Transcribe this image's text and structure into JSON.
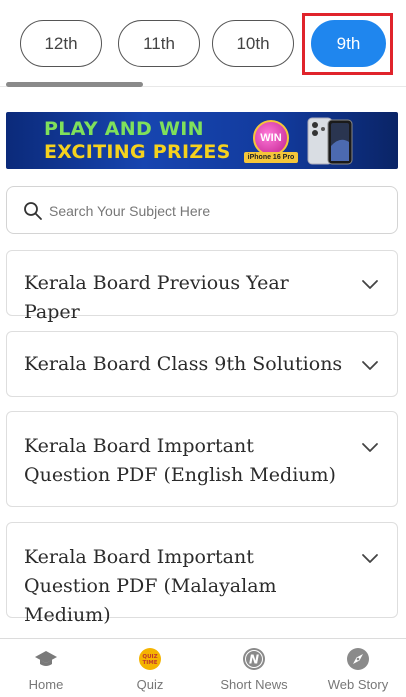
{
  "class_tabs": [
    {
      "label": "12th",
      "active": false
    },
    {
      "label": "11th",
      "active": false
    },
    {
      "label": "10th",
      "active": false
    },
    {
      "label": "9th",
      "active": true
    }
  ],
  "colors": {
    "active_tab": "#1f86ee",
    "highlight_box": "#e0232b",
    "banner_green": "#7fe05b",
    "banner_yellow": "#f5d21e",
    "banner_bg": "#1745b0"
  },
  "banner": {
    "line1": "PLAY AND WIN",
    "line2": "EXCITING PRIZES",
    "badge": "WIN",
    "phone_caption": "iPhone 16 Pro"
  },
  "search": {
    "placeholder": "Search Your Subject Here",
    "value": "",
    "icon": "search-icon"
  },
  "accordions": [
    {
      "title": "Kerala Board Previous Year Paper",
      "expanded": false
    },
    {
      "title": "Kerala Board Class 9th Solutions",
      "expanded": false
    },
    {
      "title": "Kerala Board Important Question PDF (English Medium)",
      "expanded": false
    },
    {
      "title": "Kerala Board Important Question PDF (Malayalam Medium)",
      "expanded": false
    }
  ],
  "bottom_nav": [
    {
      "label": "Home",
      "icon": "graduation-cap-icon"
    },
    {
      "label": "Quiz",
      "icon": "quiz-time-icon",
      "icon_text": "QUIZ TIME"
    },
    {
      "label": "Short News",
      "icon": "news-icon",
      "icon_text": "N"
    },
    {
      "label": "Web Story",
      "icon": "compass-icon"
    }
  ]
}
